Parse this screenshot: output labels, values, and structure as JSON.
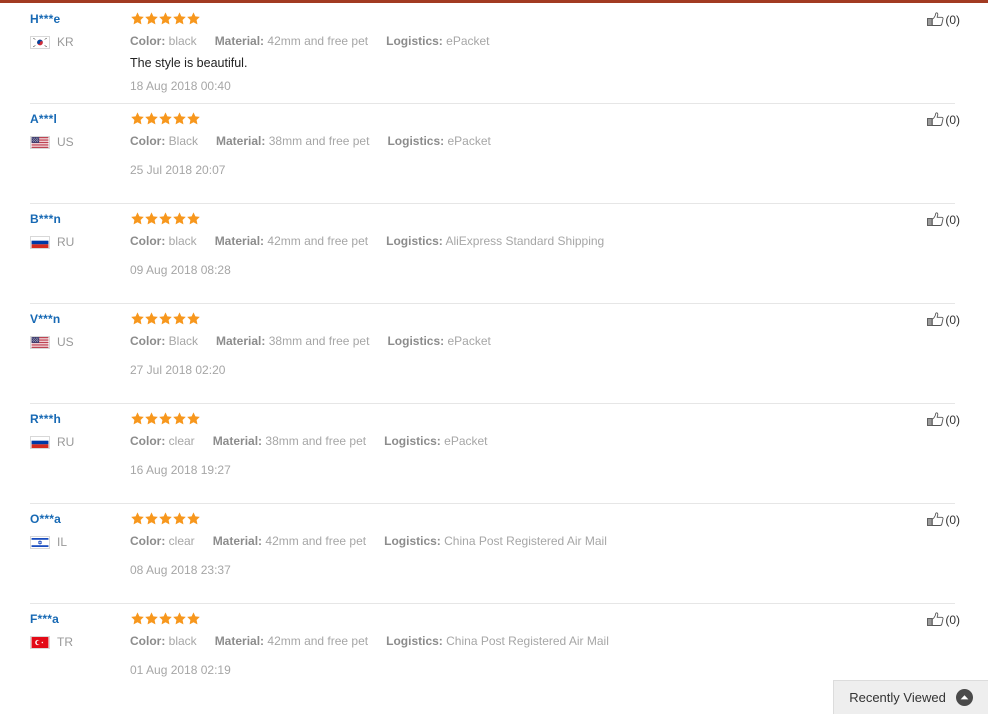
{
  "theme": {
    "top_border_color": "#a23b22",
    "username_color": "#1769b4",
    "star_color": "#f7971d",
    "label_color": "#8c8c8c",
    "value_color": "#a6a6a6"
  },
  "labels": {
    "color": "Color:",
    "material": "Material:",
    "logistics": "Logistics:"
  },
  "reviews": [
    {
      "user": "H***e",
      "country_code": "KR",
      "flag": "flag-kr",
      "rating": 5,
      "color": "black",
      "material": "42mm and free pet",
      "logistics": "ePacket",
      "text": "The style is beautiful.",
      "date": "18 Aug 2018 00:40",
      "helpful": "(0)"
    },
    {
      "user": "A***l",
      "country_code": "US",
      "flag": "flag-us",
      "rating": 5,
      "color": "Black",
      "material": "38mm and free pet",
      "logistics": "ePacket",
      "text": "",
      "date": "25 Jul 2018 20:07",
      "helpful": "(0)"
    },
    {
      "user": "B***n",
      "country_code": "RU",
      "flag": "flag-ru",
      "rating": 5,
      "color": "black",
      "material": "42mm and free pet",
      "logistics": "AliExpress Standard Shipping",
      "text": "",
      "date": "09 Aug 2018 08:28",
      "helpful": "(0)"
    },
    {
      "user": "V***n",
      "country_code": "US",
      "flag": "flag-us",
      "rating": 5,
      "color": "Black",
      "material": "38mm and free pet",
      "logistics": "ePacket",
      "text": "",
      "date": "27 Jul 2018 02:20",
      "helpful": "(0)"
    },
    {
      "user": "R***h",
      "country_code": "RU",
      "flag": "flag-ru",
      "rating": 5,
      "color": "clear",
      "material": "38mm and free pet",
      "logistics": "ePacket",
      "text": "",
      "date": "16 Aug 2018 19:27",
      "helpful": "(0)"
    },
    {
      "user": "O***a",
      "country_code": "IL",
      "flag": "flag-il",
      "rating": 5,
      "color": "clear",
      "material": "42mm and free pet",
      "logistics": "China Post Registered Air Mail",
      "text": "",
      "date": "08 Aug 2018 23:37",
      "helpful": "(0)"
    },
    {
      "user": "F***a",
      "country_code": "TR",
      "flag": "flag-tr",
      "rating": 5,
      "color": "black",
      "material": "42mm and free pet",
      "logistics": "China Post Registered Air Mail",
      "text": "",
      "date": "01 Aug 2018 02:19",
      "helpful": "(0)"
    }
  ],
  "recently_viewed": {
    "label": "Recently Viewed",
    "icon": "chevron-up-circle-icon"
  }
}
